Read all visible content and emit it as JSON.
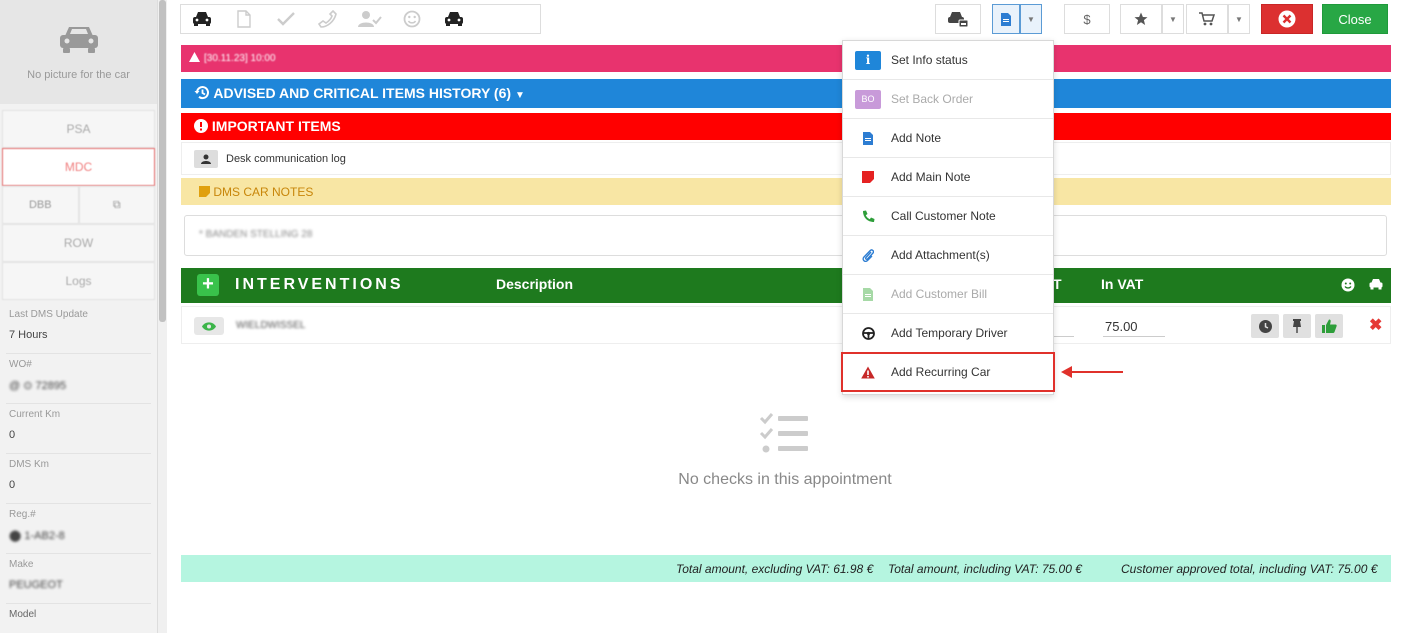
{
  "sidebar": {
    "no_picture_text": "No picture for the car",
    "buttons": {
      "psa": "PSA",
      "mdc": "MDC",
      "dbb": "DBB",
      "row": "ROW",
      "logs": "Logs"
    },
    "fields": [
      {
        "label": "Last DMS Update",
        "value": "7 Hours"
      },
      {
        "label": "WO#",
        "value": "@ ⊙ 72895"
      },
      {
        "label": "Current Km",
        "value": "0"
      },
      {
        "label": "DMS Km",
        "value": "0"
      },
      {
        "label": "Reg.#",
        "value": "⬤ 1-AB2-8"
      },
      {
        "label": "Make",
        "value": "PEUGEOT"
      },
      {
        "label": "Model",
        "value": ""
      }
    ]
  },
  "toolbar": {
    "close_label": "Close",
    "dollar_label": "$"
  },
  "alert_bar": {
    "text": "[30.11.23] 10:00"
  },
  "history_bar": {
    "label": "ADVISED AND CRITICAL ITEMS HISTORY (6)"
  },
  "important_bar": {
    "label": "IMPORTANT ITEMS"
  },
  "desk_row": {
    "label": "Desk communication log"
  },
  "dms_bar": {
    "label": "DMS CAR NOTES"
  },
  "dms_note": {
    "text": "* BANDEN STELLING 28"
  },
  "interventions": {
    "title": "INTERVENTIONS",
    "col_description": "Description",
    "col_ex_vat_tail": "T",
    "col_in_vat": "In VAT",
    "row": {
      "name": "WIELDWISSEL",
      "in_vat": "75.00"
    }
  },
  "empty_checks": {
    "text": "No checks in this appointment"
  },
  "totals": {
    "excl": "Total amount, excluding VAT: 61.98 €",
    "incl": "Total amount, including VAT: 75.00 €",
    "approved": "Customer approved total, including VAT: 75.00 €"
  },
  "dropdown": {
    "items": [
      {
        "label": "Set Info status",
        "icon": "info-icon"
      },
      {
        "label": "Set Back Order",
        "icon": "bo-icon"
      },
      {
        "label": "Add Note",
        "icon": "note-icon"
      },
      {
        "label": "Add Main Note",
        "icon": "main-note-icon"
      },
      {
        "label": "Call Customer Note",
        "icon": "phone-icon"
      },
      {
        "label": "Add Attachment(s)",
        "icon": "paperclip-icon"
      },
      {
        "label": "Add Customer Bill",
        "icon": "bill-icon"
      },
      {
        "label": "Add Temporary Driver",
        "icon": "steering-wheel-icon"
      },
      {
        "label": "Add Recurring Car",
        "icon": "warning-icon"
      }
    ],
    "bo_badge": "BO",
    "info_badge": "i"
  },
  "colors": {
    "alert": "#e8336e",
    "history": "#1f86d9",
    "important": "#ff0000",
    "interventions": "#1e7a1e",
    "totals": "#b5f5e0",
    "close": "#28a745",
    "highlight": "#e0312b"
  }
}
